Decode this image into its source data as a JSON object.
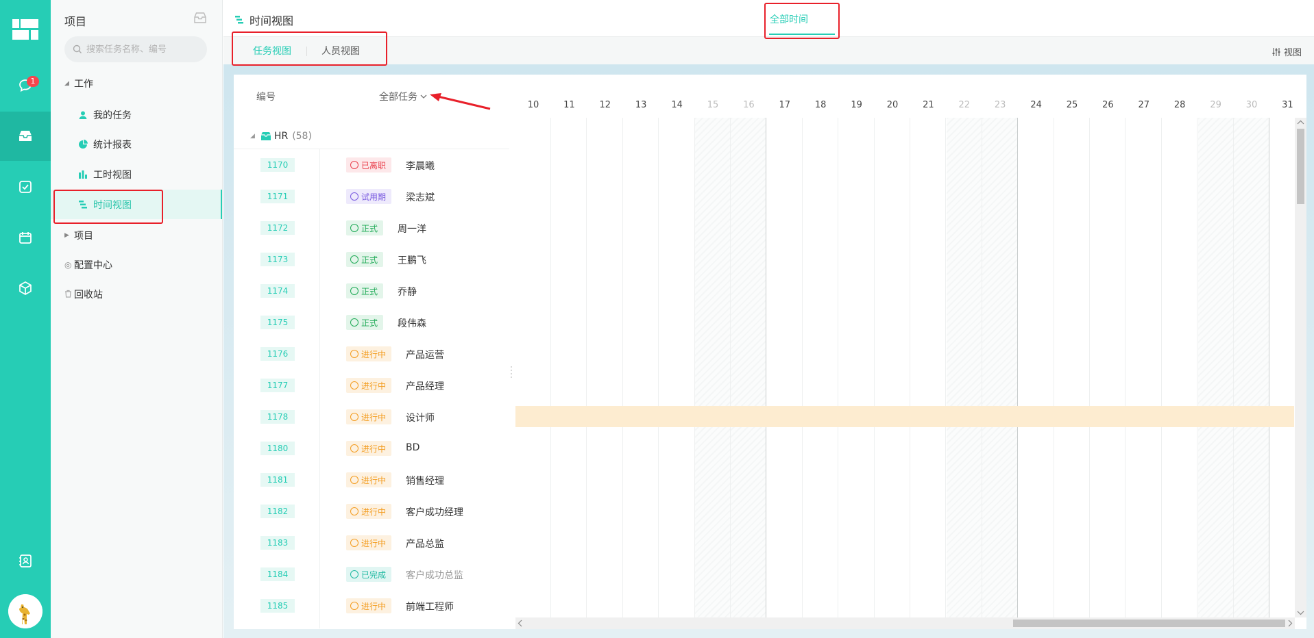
{
  "rail": {
    "message_badge": "1"
  },
  "sidebar": {
    "title": "项目",
    "search_placeholder": "搜索任务名称、编号",
    "work_group": "工作",
    "items": [
      {
        "label": "我的任务",
        "icon": "user-icon"
      },
      {
        "label": "统计报表",
        "icon": "pie-chart-icon"
      },
      {
        "label": "工时视图",
        "icon": "bar-chart-icon"
      },
      {
        "label": "时间视图",
        "icon": "timeline-icon"
      }
    ],
    "project_group": "项目",
    "config_center": "配置中心",
    "recycle_bin": "回收站"
  },
  "header": {
    "title": "时间视图",
    "tab_all_time": "全部时间"
  },
  "subtabs": {
    "task_view": "任务视图",
    "people_view": "人员视图",
    "view_button": "视图"
  },
  "list": {
    "col_id": "编号",
    "filter_all_tasks": "全部任务",
    "group_name": "HR",
    "group_count": "(58)",
    "rows": [
      {
        "id": "1170",
        "status": "已离职",
        "name": "李晨曦"
      },
      {
        "id": "1171",
        "status": "试用期",
        "name": "梁志斌"
      },
      {
        "id": "1172",
        "status": "正式",
        "name": "周一洋"
      },
      {
        "id": "1173",
        "status": "正式",
        "name": "王鹏飞"
      },
      {
        "id": "1174",
        "status": "正式",
        "name": "乔静"
      },
      {
        "id": "1175",
        "status": "正式",
        "name": "段伟森"
      },
      {
        "id": "1176",
        "status": "进行中",
        "name": "产品运营"
      },
      {
        "id": "1177",
        "status": "进行中",
        "name": "产品经理"
      },
      {
        "id": "1178",
        "status": "进行中",
        "name": "设计师"
      },
      {
        "id": "1180",
        "status": "进行中",
        "name": "BD"
      },
      {
        "id": "1181",
        "status": "进行中",
        "name": "销售经理"
      },
      {
        "id": "1182",
        "status": "进行中",
        "name": "客户成功经理"
      },
      {
        "id": "1183",
        "status": "进行中",
        "name": "产品总监"
      },
      {
        "id": "1184",
        "status": "已完成",
        "name": "客户成功总监"
      },
      {
        "id": "1185",
        "status": "进行中",
        "name": "前端工程师"
      }
    ]
  },
  "gantt": {
    "days": [
      "10",
      "11",
      "12",
      "13",
      "14",
      "15",
      "16",
      "17",
      "18",
      "19",
      "20",
      "21",
      "22",
      "23",
      "24",
      "25",
      "26",
      "27",
      "28",
      "29",
      "30",
      "31"
    ],
    "weekend_days": [
      "15",
      "16",
      "22",
      "23",
      "29",
      "30"
    ],
    "highlighted_task": "1178"
  },
  "colors": {
    "brand": "#26cdb5",
    "annotation": "#e8202a"
  }
}
